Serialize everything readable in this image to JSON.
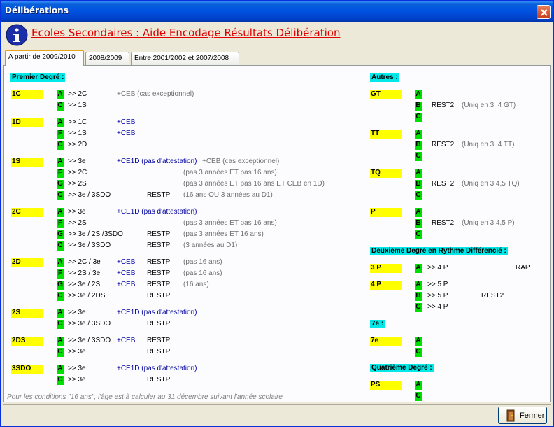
{
  "window": {
    "title": "Délibérations"
  },
  "header": {
    "title": "Ecoles Secondaires : Aide Encodage Résultats Délibération"
  },
  "tabs": [
    "A partir de 2009/2010",
    "2008/2009",
    "Entre 2001/2002 et 2007/2008"
  ],
  "left": {
    "title": "Premier Degré :",
    "groups": [
      {
        "name": "1C",
        "rows": [
          {
            "code": "A",
            "dest": ">> 2C",
            "ceb": "",
            "cond": "+CEB (cas exceptionnel)",
            "rest": ""
          },
          {
            "code": "C",
            "dest": ">> 1S",
            "ceb": "",
            "cond": "",
            "rest": ""
          }
        ]
      },
      {
        "name": "1D",
        "rows": [
          {
            "code": "A",
            "dest": ">> 1C",
            "ceb": "+CEB",
            "cond": "",
            "rest": ""
          },
          {
            "code": "F",
            "dest": ">> 1S",
            "ceb": "+CEB",
            "cond": "",
            "rest": ""
          },
          {
            "code": "C",
            "dest": ">> 2D",
            "ceb": "",
            "cond": "",
            "rest": ""
          }
        ]
      },
      {
        "name": "1S",
        "rows": [
          {
            "code": "A",
            "dest": ">> 3e",
            "ceb": "+CE1D (pas d'attestation)",
            "cond": "+CEB (cas exceptionnel)",
            "rest": ""
          },
          {
            "code": "F",
            "dest": ">> 2C",
            "ceb": "",
            "cond": "(pas 3 années ET pas 16 ans)",
            "rest": ""
          },
          {
            "code": "G",
            "dest": ">> 2S",
            "ceb": "",
            "cond": "(pas 3 années ET pas 16 ans ET CEB en 1D)",
            "rest": ""
          },
          {
            "code": "C",
            "dest": ">> 3e / 3SDO",
            "ceb": "",
            "cond": "(16 ans OU 3 années au D1)",
            "rest": "RESTP"
          }
        ]
      },
      {
        "name": "2C",
        "rows": [
          {
            "code": "A",
            "dest": ">> 3e",
            "ceb": "+CE1D (pas d'attestation)",
            "cond": "",
            "rest": ""
          },
          {
            "code": "F",
            "dest": ">> 2S",
            "ceb": "",
            "cond": "(pas 3 années ET pas 16 ans)",
            "rest": ""
          },
          {
            "code": "G",
            "dest": ">> 3e / 2S /3SDO",
            "ceb": "",
            "cond": "(pas 3 années ET 16 ans)",
            "rest": "RESTP"
          },
          {
            "code": "C",
            "dest": ">> 3e / 3SDO",
            "ceb": "",
            "cond": "(3 années au D1)",
            "rest": "RESTP"
          }
        ]
      },
      {
        "name": "2D",
        "rows": [
          {
            "code": "A",
            "dest": ">> 2C / 3e",
            "ceb": "+CEB",
            "cond": "(pas 16 ans)",
            "rest": "RESTP"
          },
          {
            "code": "F",
            "dest": ">> 2S / 3e",
            "ceb": "+CEB",
            "cond": "(pas 16 ans)",
            "rest": "RESTP"
          },
          {
            "code": "G",
            "dest": ">> 3e / 2S",
            "ceb": "+CEB",
            "cond": "(16 ans)",
            "rest": "RESTP"
          },
          {
            "code": "C",
            "dest": ">> 3e / 2DS",
            "ceb": "",
            "cond": "",
            "rest": "RESTP"
          }
        ]
      },
      {
        "name": "2S",
        "rows": [
          {
            "code": "A",
            "dest": ">> 3e",
            "ceb": "+CE1D (pas d'attestation)",
            "cond": "",
            "rest": ""
          },
          {
            "code": "C",
            "dest": ">> 3e / 3SDO",
            "ceb": "",
            "cond": "",
            "rest": "RESTP"
          }
        ]
      },
      {
        "name": "2DS",
        "rows": [
          {
            "code": "A",
            "dest": ">> 3e / 3SDO",
            "ceb": "+CEB",
            "cond": "",
            "rest": "RESTP"
          },
          {
            "code": "C",
            "dest": ">> 3e",
            "ceb": "",
            "cond": "",
            "rest": "RESTP"
          }
        ]
      },
      {
        "name": "3SDO",
        "rows": [
          {
            "code": "A",
            "dest": ">> 3e",
            "ceb": "+CE1D (pas d'attestation)",
            "cond": "",
            "rest": ""
          },
          {
            "code": "C",
            "dest": ">> 3e",
            "ceb": "",
            "cond": "",
            "rest": "RESTP"
          }
        ]
      }
    ]
  },
  "right": {
    "autres_title": "Autres :",
    "autres": [
      {
        "name": "GT",
        "rows": [
          {
            "code": "A",
            "rest": "",
            "cond": ""
          },
          {
            "code": "B",
            "rest": "REST2",
            "cond": "(Uniq en 3, 4 GT)"
          },
          {
            "code": "C",
            "rest": "",
            "cond": ""
          }
        ]
      },
      {
        "name": "TT",
        "rows": [
          {
            "code": "A",
            "rest": "",
            "cond": ""
          },
          {
            "code": "B",
            "rest": "REST2",
            "cond": "(Uniq en 3, 4 TT)"
          },
          {
            "code": "C",
            "rest": "",
            "cond": ""
          }
        ]
      },
      {
        "name": "TQ",
        "rows": [
          {
            "code": "A",
            "rest": "",
            "cond": ""
          },
          {
            "code": "B",
            "rest": "REST2",
            "cond": "(Uniq en 3,4,5 TQ)"
          },
          {
            "code": "C",
            "rest": "",
            "cond": ""
          }
        ]
      },
      {
        "name": "P",
        "rows": [
          {
            "code": "A",
            "rest": "",
            "cond": ""
          },
          {
            "code": "B",
            "rest": "REST2",
            "cond": "(Uniq en 3,4,5 P)"
          },
          {
            "code": "C",
            "rest": "",
            "cond": ""
          }
        ]
      }
    ],
    "d2_title": "Deuxième Degré en Rythme Différencié :",
    "d2": [
      {
        "name": "3 P",
        "rows": [
          {
            "code": "A",
            "dest": ">> 4 P",
            "rest": "RAP"
          }
        ]
      },
      {
        "name": "4 P",
        "rows": [
          {
            "code": "A",
            "dest": ">> 5 P",
            "rest": ""
          },
          {
            "code": "B",
            "dest": ">> 5 P",
            "rest": "REST2"
          },
          {
            "code": "C",
            "dest": ">> 4 P",
            "rest": ""
          }
        ]
      }
    ],
    "s7_title": "7e :",
    "s7": [
      {
        "name": "7e",
        "rows": [
          {
            "code": "A"
          },
          {
            "code": "C"
          }
        ]
      }
    ],
    "d4_title": "Quatrième Degré :",
    "d4": [
      {
        "name": "PS",
        "rows": [
          {
            "code": "A"
          },
          {
            "code": "C"
          }
        ]
      }
    ]
  },
  "footer": {
    "note": "Pour les conditions \"16 ans\", l'âge est à calculer au 31 décembre suivant l'année scolaire",
    "close_label": "Fermer"
  }
}
